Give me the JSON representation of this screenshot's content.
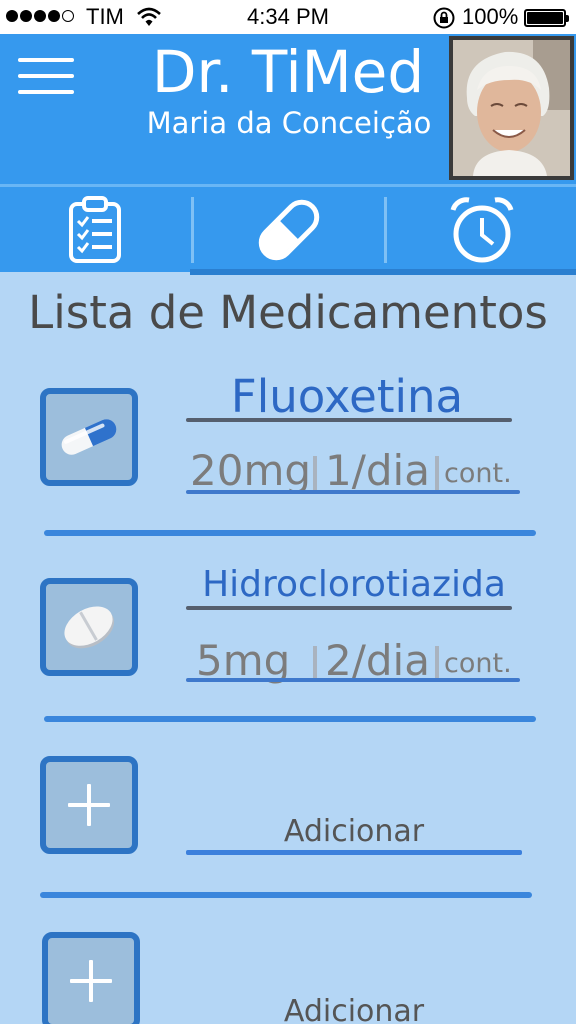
{
  "status_bar": {
    "carrier": "TIM",
    "time": "4:34 PM",
    "battery": "100%",
    "battery_level": 1.0,
    "icons": [
      "signal-dots-icon",
      "wifi-icon",
      "rotation-lock-icon",
      "battery-icon"
    ]
  },
  "header": {
    "title": "Dr. TiMed",
    "user_name": "Maria da Conceição",
    "menu_icon": "hamburger-menu-icon",
    "avatar": "user-photo-avatar"
  },
  "tabs": [
    {
      "icon": "clipboard-checklist-icon",
      "selected": true
    },
    {
      "icon": "pill-capsule-icon",
      "selected": false
    },
    {
      "icon": "alarm-clock-icon",
      "selected": false
    }
  ],
  "section_title": "Lista de Medicamentos",
  "medications": [
    {
      "name": "Fluoxetina",
      "dose": "20mg",
      "frequency": "1/dia",
      "duration": "cont.",
      "icon": "capsule-icon"
    },
    {
      "name": "Hidroclorotiazida",
      "dose": "5mg",
      "frequency": "2/dia",
      "duration": "cont.",
      "icon": "tablet-icon"
    }
  ],
  "add_slots": [
    {
      "label": "Adicionar",
      "icon": "plus-icon"
    },
    {
      "label": "Adicionar",
      "icon": "plus-icon"
    }
  ],
  "colors": {
    "header_blue": "#3699ee",
    "background": "#b4d6f5",
    "accent_blue": "#2d74c4",
    "name_text": "#2d68c4",
    "detail_text": "#7c7c7c"
  }
}
